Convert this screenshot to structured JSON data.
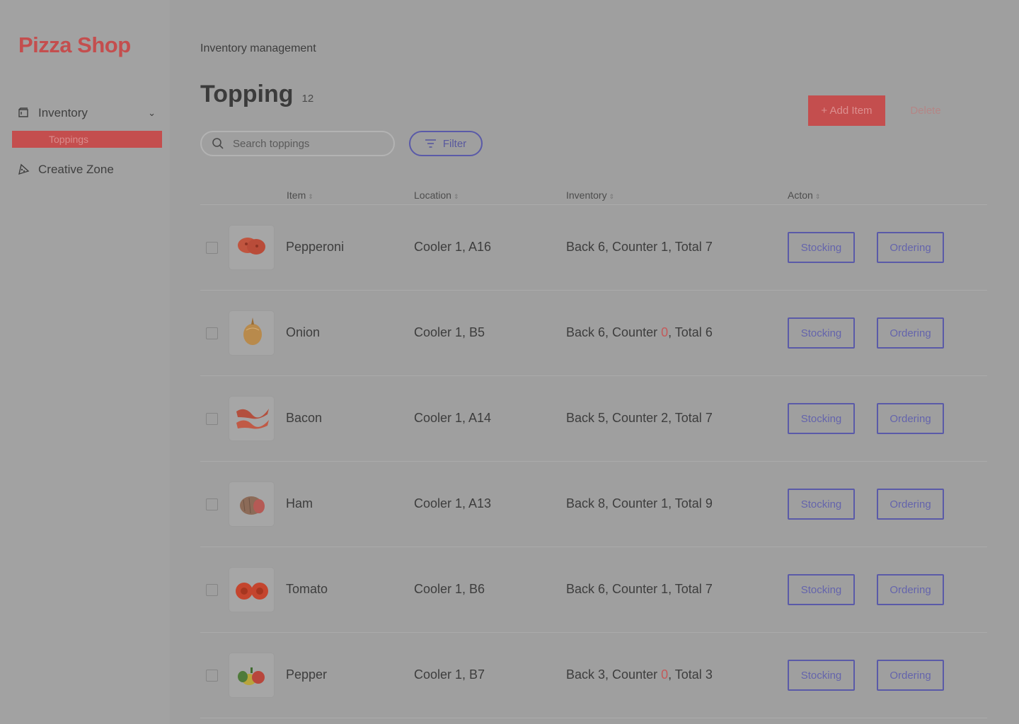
{
  "app": {
    "logo": "Pizza Shop"
  },
  "sidebar": {
    "inventory_label": "Inventory",
    "sub_item_label": "Toppings",
    "creative_label": "Creative Zone"
  },
  "breadcrumb": "Inventory management",
  "page": {
    "title": "Topping",
    "count": "12"
  },
  "actions": {
    "add_label": "+ Add Item",
    "delete_label": "Delete"
  },
  "search": {
    "placeholder": "Search toppings"
  },
  "filter": {
    "label": "Filter"
  },
  "table": {
    "headers": {
      "item": "Item",
      "location": "Location",
      "inventory": "Inventory",
      "action": "Acton"
    },
    "stocking_label": "Stocking",
    "ordering_label": "Ordering",
    "rows": [
      {
        "name": "Pepperoni",
        "location": "Cooler 1, A16",
        "back": "6",
        "counter": "1",
        "total": "7",
        "icon": "pepperoni-icon"
      },
      {
        "name": "Onion",
        "location": "Cooler 1, B5",
        "back": "6",
        "counter": "0",
        "total": "6",
        "icon": "onion-icon"
      },
      {
        "name": "Bacon",
        "location": "Cooler 1, A14",
        "back": "5",
        "counter": "2",
        "total": "7",
        "icon": "bacon-icon"
      },
      {
        "name": "Ham",
        "location": "Cooler 1, A13",
        "back": "8",
        "counter": "1",
        "total": "9",
        "icon": "ham-icon"
      },
      {
        "name": "Tomato",
        "location": "Cooler 1, B6",
        "back": "6",
        "counter": "1",
        "total": "7",
        "icon": "tomato-icon"
      },
      {
        "name": "Pepper",
        "location": "Cooler 1, B7",
        "back": "3",
        "counter": "0",
        "total": "3",
        "icon": "pepper-icon"
      }
    ]
  },
  "colors": {
    "brand": "#c44e4e",
    "accent": "#5a5aa8",
    "warning": "#c45a5a"
  }
}
